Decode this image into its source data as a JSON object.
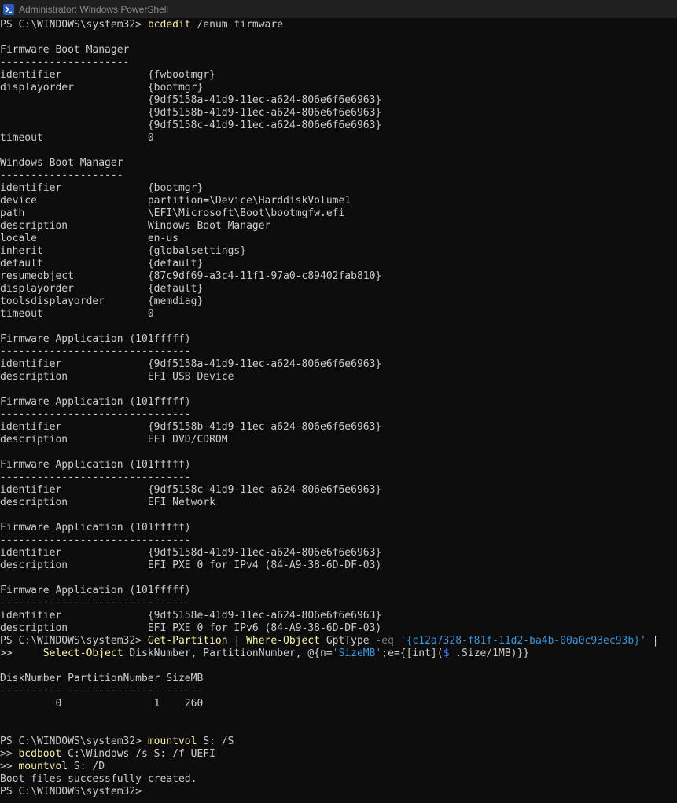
{
  "window": {
    "title": "Administrator: Windows PowerShell",
    "icon": "powershell-icon"
  },
  "colors": {
    "background": "#0c0c0c",
    "text": "#cccccc",
    "command": "#f9f1a5",
    "operator": "#767676",
    "string": "#3a96dd",
    "variable": "#3b78ff"
  },
  "console": {
    "lines": [
      [
        {
          "t": "PS C:\\WINDOWS\\system32> ",
          "c": "plain"
        },
        {
          "t": "bcdedit",
          "c": "cmd"
        },
        {
          "t": " /enum firmware",
          "c": "plain"
        }
      ],
      [],
      [
        {
          "t": "Firmware Boot Manager",
          "c": "plain"
        }
      ],
      [
        {
          "t": "---------------------",
          "c": "plain"
        }
      ],
      [
        {
          "t": "identifier              {fwbootmgr}",
          "c": "plain"
        }
      ],
      [
        {
          "t": "displayorder            {bootmgr}",
          "c": "plain"
        }
      ],
      [
        {
          "t": "                        {9df5158a-41d9-11ec-a624-806e6f6e6963}",
          "c": "plain"
        }
      ],
      [
        {
          "t": "                        {9df5158b-41d9-11ec-a624-806e6f6e6963}",
          "c": "plain"
        }
      ],
      [
        {
          "t": "                        {9df5158c-41d9-11ec-a624-806e6f6e6963}",
          "c": "plain"
        }
      ],
      [
        {
          "t": "timeout                 0",
          "c": "plain"
        }
      ],
      [],
      [
        {
          "t": "Windows Boot Manager",
          "c": "plain"
        }
      ],
      [
        {
          "t": "--------------------",
          "c": "plain"
        }
      ],
      [
        {
          "t": "identifier              {bootmgr}",
          "c": "plain"
        }
      ],
      [
        {
          "t": "device                  partition=\\Device\\HarddiskVolume1",
          "c": "plain"
        }
      ],
      [
        {
          "t": "path                    \\EFI\\Microsoft\\Boot\\bootmgfw.efi",
          "c": "plain"
        }
      ],
      [
        {
          "t": "description             Windows Boot Manager",
          "c": "plain"
        }
      ],
      [
        {
          "t": "locale                  en-us",
          "c": "plain"
        }
      ],
      [
        {
          "t": "inherit                 {globalsettings}",
          "c": "plain"
        }
      ],
      [
        {
          "t": "default                 {default}",
          "c": "plain"
        }
      ],
      [
        {
          "t": "resumeobject            {87c9df69-a3c4-11f1-97a0-c89402fab810}",
          "c": "plain"
        }
      ],
      [
        {
          "t": "displayorder            {default}",
          "c": "plain"
        }
      ],
      [
        {
          "t": "toolsdisplayorder       {memdiag}",
          "c": "plain"
        }
      ],
      [
        {
          "t": "timeout                 0",
          "c": "plain"
        }
      ],
      [],
      [
        {
          "t": "Firmware Application (101fffff)",
          "c": "plain"
        }
      ],
      [
        {
          "t": "-------------------------------",
          "c": "plain"
        }
      ],
      [
        {
          "t": "identifier              {9df5158a-41d9-11ec-a624-806e6f6e6963}",
          "c": "plain"
        }
      ],
      [
        {
          "t": "description             EFI USB Device",
          "c": "plain"
        }
      ],
      [],
      [
        {
          "t": "Firmware Application (101fffff)",
          "c": "plain"
        }
      ],
      [
        {
          "t": "-------------------------------",
          "c": "plain"
        }
      ],
      [
        {
          "t": "identifier              {9df5158b-41d9-11ec-a624-806e6f6e6963}",
          "c": "plain"
        }
      ],
      [
        {
          "t": "description             EFI DVD/CDROM",
          "c": "plain"
        }
      ],
      [],
      [
        {
          "t": "Firmware Application (101fffff)",
          "c": "plain"
        }
      ],
      [
        {
          "t": "-------------------------------",
          "c": "plain"
        }
      ],
      [
        {
          "t": "identifier              {9df5158c-41d9-11ec-a624-806e6f6e6963}",
          "c": "plain"
        }
      ],
      [
        {
          "t": "description             EFI Network",
          "c": "plain"
        }
      ],
      [],
      [
        {
          "t": "Firmware Application (101fffff)",
          "c": "plain"
        }
      ],
      [
        {
          "t": "-------------------------------",
          "c": "plain"
        }
      ],
      [
        {
          "t": "identifier              {9df5158d-41d9-11ec-a624-806e6f6e6963}",
          "c": "plain"
        }
      ],
      [
        {
          "t": "description             EFI PXE 0 for IPv4 (84-A9-38-6D-DF-03)",
          "c": "plain"
        }
      ],
      [],
      [
        {
          "t": "Firmware Application (101fffff)",
          "c": "plain"
        }
      ],
      [
        {
          "t": "-------------------------------",
          "c": "plain"
        }
      ],
      [
        {
          "t": "identifier              {9df5158e-41d9-11ec-a624-806e6f6e6963}",
          "c": "plain"
        }
      ],
      [
        {
          "t": "description             EFI PXE 0 for IPv6 (84-A9-38-6D-DF-03)",
          "c": "plain"
        }
      ],
      [
        {
          "t": "PS C:\\WINDOWS\\system32> ",
          "c": "plain"
        },
        {
          "t": "Get-Partition",
          "c": "cmd"
        },
        {
          "t": " | ",
          "c": "plain"
        },
        {
          "t": "Where-Object",
          "c": "cmd"
        },
        {
          "t": " GptType ",
          "c": "plain"
        },
        {
          "t": "-eq",
          "c": "op"
        },
        {
          "t": " ",
          "c": "plain"
        },
        {
          "t": "'{c12a7328-f81f-11d2-ba4b-00a0c93ec93b}'",
          "c": "str"
        },
        {
          "t": " |",
          "c": "plain"
        }
      ],
      [
        {
          "t": ">>     ",
          "c": "plain"
        },
        {
          "t": "Select-Object",
          "c": "cmd"
        },
        {
          "t": " DiskNumber, PartitionNumber, @{n=",
          "c": "plain"
        },
        {
          "t": "'SizeMB'",
          "c": "str"
        },
        {
          "t": ";e={[int](",
          "c": "plain"
        },
        {
          "t": "$_",
          "c": "var"
        },
        {
          "t": ".Size/1MB)}}",
          "c": "plain"
        }
      ],
      [],
      [
        {
          "t": "DiskNumber PartitionNumber SizeMB",
          "c": "plain"
        }
      ],
      [
        {
          "t": "---------- --------------- ------",
          "c": "plain"
        }
      ],
      [
        {
          "t": "         0               1    260",
          "c": "plain"
        }
      ],
      [],
      [],
      [
        {
          "t": "PS C:\\WINDOWS\\system32> ",
          "c": "plain"
        },
        {
          "t": "mountvol",
          "c": "cmd"
        },
        {
          "t": " S: /S",
          "c": "plain"
        }
      ],
      [
        {
          "t": ">> ",
          "c": "plain"
        },
        {
          "t": "bcdboot",
          "c": "cmd"
        },
        {
          "t": " C:\\Windows /s S: /f UEFI",
          "c": "plain"
        }
      ],
      [
        {
          "t": ">> ",
          "c": "plain"
        },
        {
          "t": "mountvol",
          "c": "cmd"
        },
        {
          "t": " S: /D",
          "c": "plain"
        }
      ],
      [
        {
          "t": "Boot files successfully created.",
          "c": "plain"
        }
      ],
      [
        {
          "t": "PS C:\\WINDOWS\\system32> ",
          "c": "plain"
        }
      ]
    ]
  }
}
